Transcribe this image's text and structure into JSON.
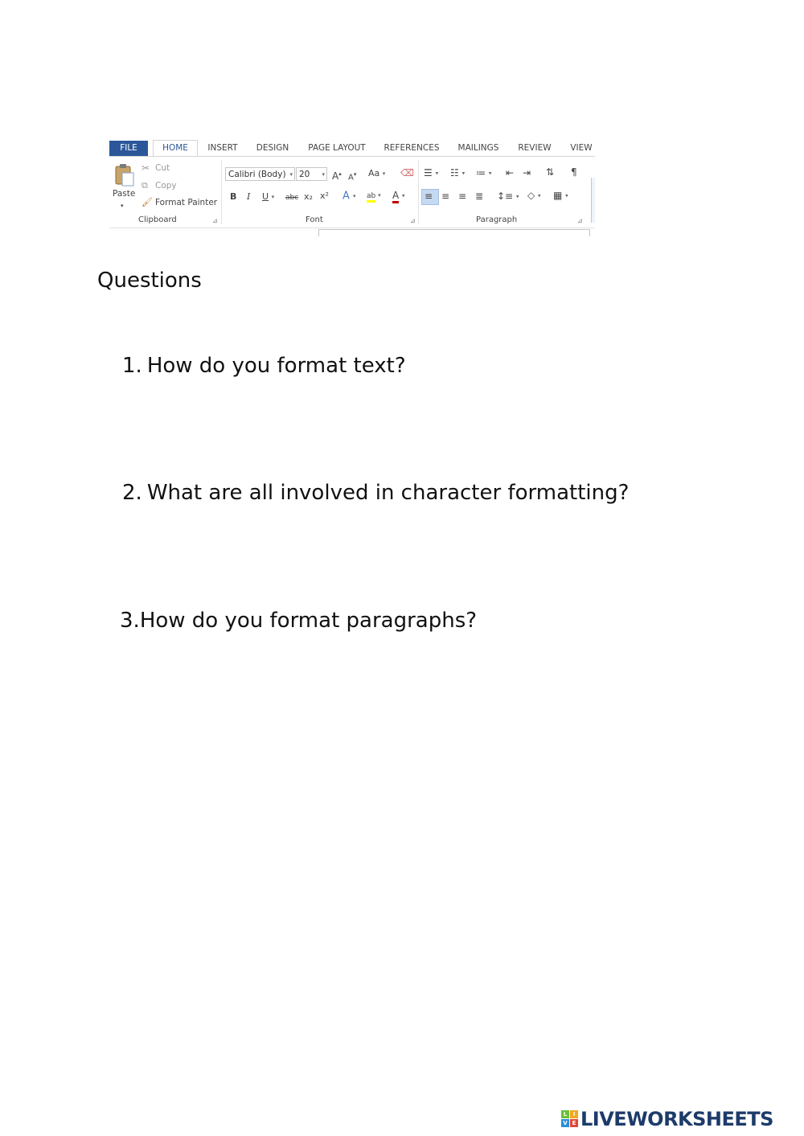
{
  "ribbon": {
    "tabs": [
      "FILE",
      "HOME",
      "INSERT",
      "DESIGN",
      "PAGE LAYOUT",
      "REFERENCES",
      "MAILINGS",
      "REVIEW",
      "VIEW"
    ],
    "clipboard": {
      "paste_label": "Paste",
      "cut_label": "Cut",
      "copy_label": "Copy",
      "format_painter_label": "Format Painter",
      "group_label": "Clipboard"
    },
    "font": {
      "font_name": "Calibri (Body)",
      "font_size": "20",
      "change_case_label": "Aa",
      "bold_label": "B",
      "italic_label": "I",
      "underline_label": "U",
      "strikethrough_label": "abc",
      "subscript_label": "x₂",
      "superscript_label": "x²",
      "text_effects_label": "A",
      "highlight_label": "ab",
      "font_color_label": "A",
      "grow_label": "A",
      "shrink_label": "A",
      "group_label": "Font"
    },
    "paragraph": {
      "show_marks_label": "¶",
      "group_label": "Paragraph"
    },
    "colors": {
      "accent": "#2b579a",
      "highlight": "#ffff00",
      "font_color": "#c00000"
    }
  },
  "document": {
    "heading": "Questions",
    "questions": [
      {
        "number": "1.",
        "text": "How do you format text?"
      },
      {
        "number": "2.",
        "text": "What are all involved in character formatting?"
      },
      {
        "number": "3.",
        "text": "How do you format paragraphs?"
      }
    ]
  },
  "branding": {
    "mark_letters": [
      "L",
      "I",
      "V",
      "E"
    ],
    "text": "LIVEWORKSHEETS"
  }
}
